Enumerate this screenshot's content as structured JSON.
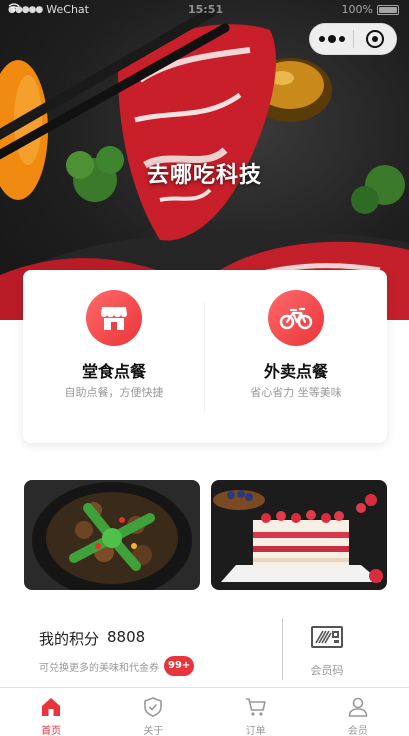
{
  "status_bar": {
    "carrier": "WeChat",
    "time": "15:51",
    "battery": "100%"
  },
  "hero": {
    "brand_title": "去哪吃科技"
  },
  "order": {
    "dine_in": {
      "title": "堂食点餐",
      "subtitle": "自助点餐，方便快捷",
      "icon": "storefront-icon"
    },
    "delivery": {
      "title": "外卖点餐",
      "subtitle": "省心省力 坐等美味",
      "icon": "bicycle-icon"
    }
  },
  "promos": [
    {
      "subject": "braised-mushroom-dish"
    },
    {
      "subject": "strawberry-layer-cake"
    }
  ],
  "points": {
    "label": "我的积分",
    "value": "8808",
    "hint": "可兑换更多的美味和代金券",
    "badge": "99+",
    "member_code_label": "会员码"
  },
  "tabbar": {
    "tabs": [
      {
        "label": "首页",
        "icon": "home-icon",
        "active": true
      },
      {
        "label": "关于",
        "icon": "shield-check-icon",
        "active": false
      },
      {
        "label": "订单",
        "icon": "cart-icon",
        "active": false
      },
      {
        "label": "会员",
        "icon": "person-icon",
        "active": false
      }
    ]
  },
  "colors": {
    "accent": "#e8353b",
    "muted_text": "#999999"
  }
}
